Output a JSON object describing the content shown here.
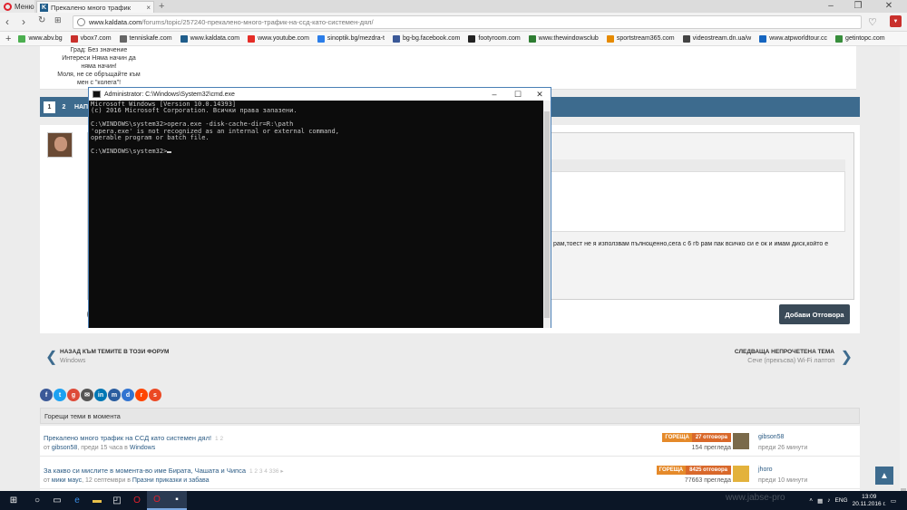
{
  "browser": {
    "menu_label": "Меню",
    "tab_title": "Прекалено много трафик",
    "tab_close": "×",
    "new_tab": "+",
    "url_host": "www.kaldata.com",
    "url_path": "/forums/topic/257240-прекалено-много-трафик-на-ссд-като-системен-дял/",
    "bookmarks": [
      {
        "label": "www.abv.bg",
        "color": "#4caf50"
      },
      {
        "label": "vbox7.com",
        "color": "#c9302c"
      },
      {
        "label": "tenniskafe.com",
        "color": "#666666"
      },
      {
        "label": "www.kaldata.com",
        "color": "#1f5d8b"
      },
      {
        "label": "www.youtube.com",
        "color": "#e52d27"
      },
      {
        "label": "sinoptik.bg/mezdra-t",
        "color": "#2b7de9"
      },
      {
        "label": "bg-bg.facebook.com",
        "color": "#3b5998"
      },
      {
        "label": "footyroom.com",
        "color": "#222222"
      },
      {
        "label": "www.thewindowsclub",
        "color": "#2e7d32"
      },
      {
        "label": "sportstream365.com",
        "color": "#e68a00"
      },
      {
        "label": "videostream.dn.ua/w",
        "color": "#444444"
      },
      {
        "label": "www.atpworldtour.cc",
        "color": "#1565c0"
      },
      {
        "label": "getintopc.com",
        "color": "#388e3c"
      }
    ]
  },
  "user_card": {
    "lines": [
      "Град: Без значение",
      "Интереси Няма начин да",
      "няма начин!",
      "Моля, не се обръщайте към",
      "мен с \"колега\"!"
    ]
  },
  "pagination": {
    "pages": [
      "1",
      "2",
      "НАПРЕД"
    ]
  },
  "post": {
    "snippet": "рам,тоест не я използвам пълноценно,сега с 6 гб рам пак всичко си е ок и имам диск,който е",
    "reply_button": "Добави Отговора"
  },
  "prevnext": {
    "prev_title": "НАЗАД КЪМ ТЕМИТЕ В ТОЗИ ФОРУМ",
    "prev_sub": "Windows",
    "next_title": "СЛЕДВАЩА НЕПРОЧЕТЕНА ТЕМА",
    "next_sub": "Сече (прекъсва) Wi-Fi лаптоп"
  },
  "share_icons": [
    {
      "name": "facebook",
      "color": "#3b5998",
      "glyph": "f"
    },
    {
      "name": "twitter",
      "color": "#1da1f2",
      "glyph": "t"
    },
    {
      "name": "google-plus",
      "color": "#dd4b39",
      "glyph": "g"
    },
    {
      "name": "email",
      "color": "#555555",
      "glyph": "✉"
    },
    {
      "name": "linkedin",
      "color": "#0077b5",
      "glyph": "in"
    },
    {
      "name": "myspace",
      "color": "#2a5d9f",
      "glyph": "m"
    },
    {
      "name": "delicious",
      "color": "#3274d1",
      "glyph": "d"
    },
    {
      "name": "reddit",
      "color": "#ff4500",
      "glyph": "r"
    },
    {
      "name": "stumbleupon",
      "color": "#eb4924",
      "glyph": "s"
    }
  ],
  "hot_topics": {
    "header": "Горещи теми в момента",
    "items": [
      {
        "title": "Прекалено много трафик на ССД като системен дял!",
        "pages": "1  2",
        "meta_prefix": "от ",
        "author": "gibson58",
        "meta_mid": ", преди 15 часа в ",
        "forum": "Windows",
        "badge_label": "ГОРЕЩА",
        "replies": "27 отговора",
        "views": "154 прегледа",
        "last_user": "gibson58",
        "last_when": "преди 26 минути"
      },
      {
        "title": "За какво си мислите в момента-во име Бирата, Чашата и Чипса",
        "pages": "1  2  3  4  336 ▸",
        "meta_prefix": "от ",
        "author": "мики маус",
        "meta_mid": ", 12 септември в ",
        "forum": "Празни приказки и забава",
        "badge_label": "ГОРЕЩА",
        "replies": "8425 отговора",
        "views": "77663 прегледа",
        "last_user": "jhoro",
        "last_when": "преди 10 минути"
      }
    ]
  },
  "cmd": {
    "title": "Administrator: C:\\Windows\\System32\\cmd.exe",
    "lines": [
      "Microsoft Windows [Version 10.0.14393]",
      "(c) 2016 Microsoft Corporation. Всички права запазени.",
      "",
      "C:\\WINDOWS\\system32>opera.exe -disk-cache-dir=R:\\path",
      "'opera.exe' is not recognized as an internal or external command,",
      "operable program or batch file.",
      "",
      "C:\\WINDOWS\\system32>"
    ]
  },
  "taskbar": {
    "lang": "ENG",
    "time": "13:09",
    "date": "20.11.2016 г.",
    "watermark": "www.jabse-pro"
  }
}
